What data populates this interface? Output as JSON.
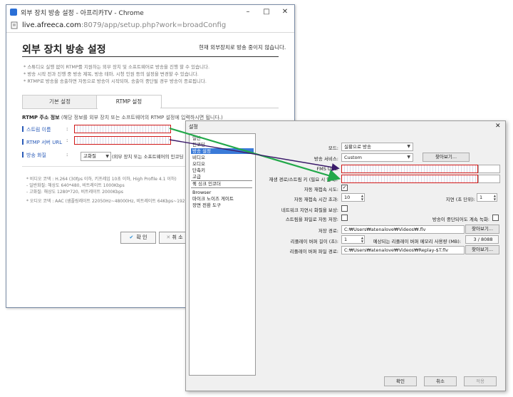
{
  "chrome": {
    "window_title": "외부 장치 방송 설정 - 아프리카TV - Chrome",
    "url_host": "live.afreeca.com",
    "url_rest": ":8079/app/setup.php?work=broadConfig",
    "min_btn": "–",
    "max_btn": "□",
    "close_btn": "✕"
  },
  "page": {
    "title": "외부 장치 방송 설정",
    "status": "현재 외부장치로 방송 중이지 않습니다.",
    "notes": [
      "* 스튜디오 실행 없이 RTMP를 지원하는 외부 장치 및 소프트웨어로 방송을 진행 할 수 있습니다.",
      "* 방송 시작 전과 진행 중 방송 제목, 방송 테마, 시청 인원 등의 설정을 변경할 수 있습니다.",
      "* RTMP로 방송을 송출하면 자동으로 방송이 시작되며, 송출이 중단될 경우 방송이 종료됩니다."
    ],
    "tabs": [
      "기본 설정",
      "RTMP 설정"
    ],
    "section_title_bold": "RTMP 주소 정보",
    "section_title_rest": " (해당 정보를 외부 장치 또는 소프트웨어의 RTMP 설정에 입력하시면 됩니다.)",
    "stream_name_label": "스트림 이름",
    "rtmp_url_label": "RTMP 서버 URL",
    "quality_label": "방송 화질",
    "colon": ":",
    "quality_value": "고화질",
    "quality_hint": "(외부 장치 또는 소프트웨어의 인코딩 설정",
    "codec_lines": [
      "* 비디오 코덱 : H.264 (30fps 이하, 키프레임 10초 이하, High Profile 4.1 이하)",
      "  - 일반화질: 해상도 640*480, 비트레이트 1000Kbps",
      "  - 고화질: 해상도 1280*720, 비트레이트 2000Kbps",
      "* 오디오 코덱 : AAC (샘플링레이트 22050Hz~48000Hz, 비트레이트 64Kbps~192K"
    ],
    "confirm_label": "확 인",
    "cancel_label": "취 소"
  },
  "dialog": {
    "title": "설정",
    "close": "✕",
    "sidebar": [
      "일반",
      "인코딩",
      "방송 설정",
      "비디오",
      "오디오",
      "단축키",
      "고급",
      "퀵 싱크 인코더",
      "Browser",
      "마이크 노이즈 게이트",
      "장면 전환 도구"
    ],
    "selected": "방송 설정",
    "mode_label": "모드:",
    "mode_value": "실황으로 방송",
    "service_label": "방송 서비스:",
    "service_value": "Custom",
    "browse_btn": "찾아보기...",
    "fms_label": "FMS URL:",
    "stream_key_label": "재생 경로/스트림 키 (필요 시 입력):",
    "auto_reconnect_label": "자동 재접속 시도:",
    "reconnect_timeout_label": "자동 재접속 시간 초과:",
    "reconnect_timeout_value": "10",
    "delay_label": "지연 (초 단위):",
    "delay_value": "1",
    "network_opt_label": "네트워크 지연시 화질을 보상:",
    "save_stream_label": "스트림을 파일로 자동 저장:",
    "keep_recording_label": "방송이 중단되어도 계속 녹화:",
    "save_path_label": "저장 경로:",
    "save_path_value": "C:₩Users₩atenalove₩Videos₩.flv",
    "replay_len_label": "리플레이 버퍼 길이 (초):",
    "replay_len_value": "1",
    "replay_mem_label": "예상되는 리플레이 버퍼 메모리 사용량 (MB):",
    "replay_mem_value": "3 / 8088",
    "replay_path_label": "리플레이 버퍼 파일 경로:",
    "replay_path_value": "C:₩Users₩atenalove₩Videos₩Replay-$T.flv",
    "ok_btn": "확인",
    "cancel_btn": "취소",
    "apply_btn": "적용",
    "checkmark": "✓"
  },
  "colors": {
    "label_blue": "#2a5bb8",
    "highlight_red": "#d01818",
    "arrow_green": "#22a84a",
    "arrow_purple": "#3a1a6a",
    "sidebar_selected": "#3a7ad8"
  }
}
